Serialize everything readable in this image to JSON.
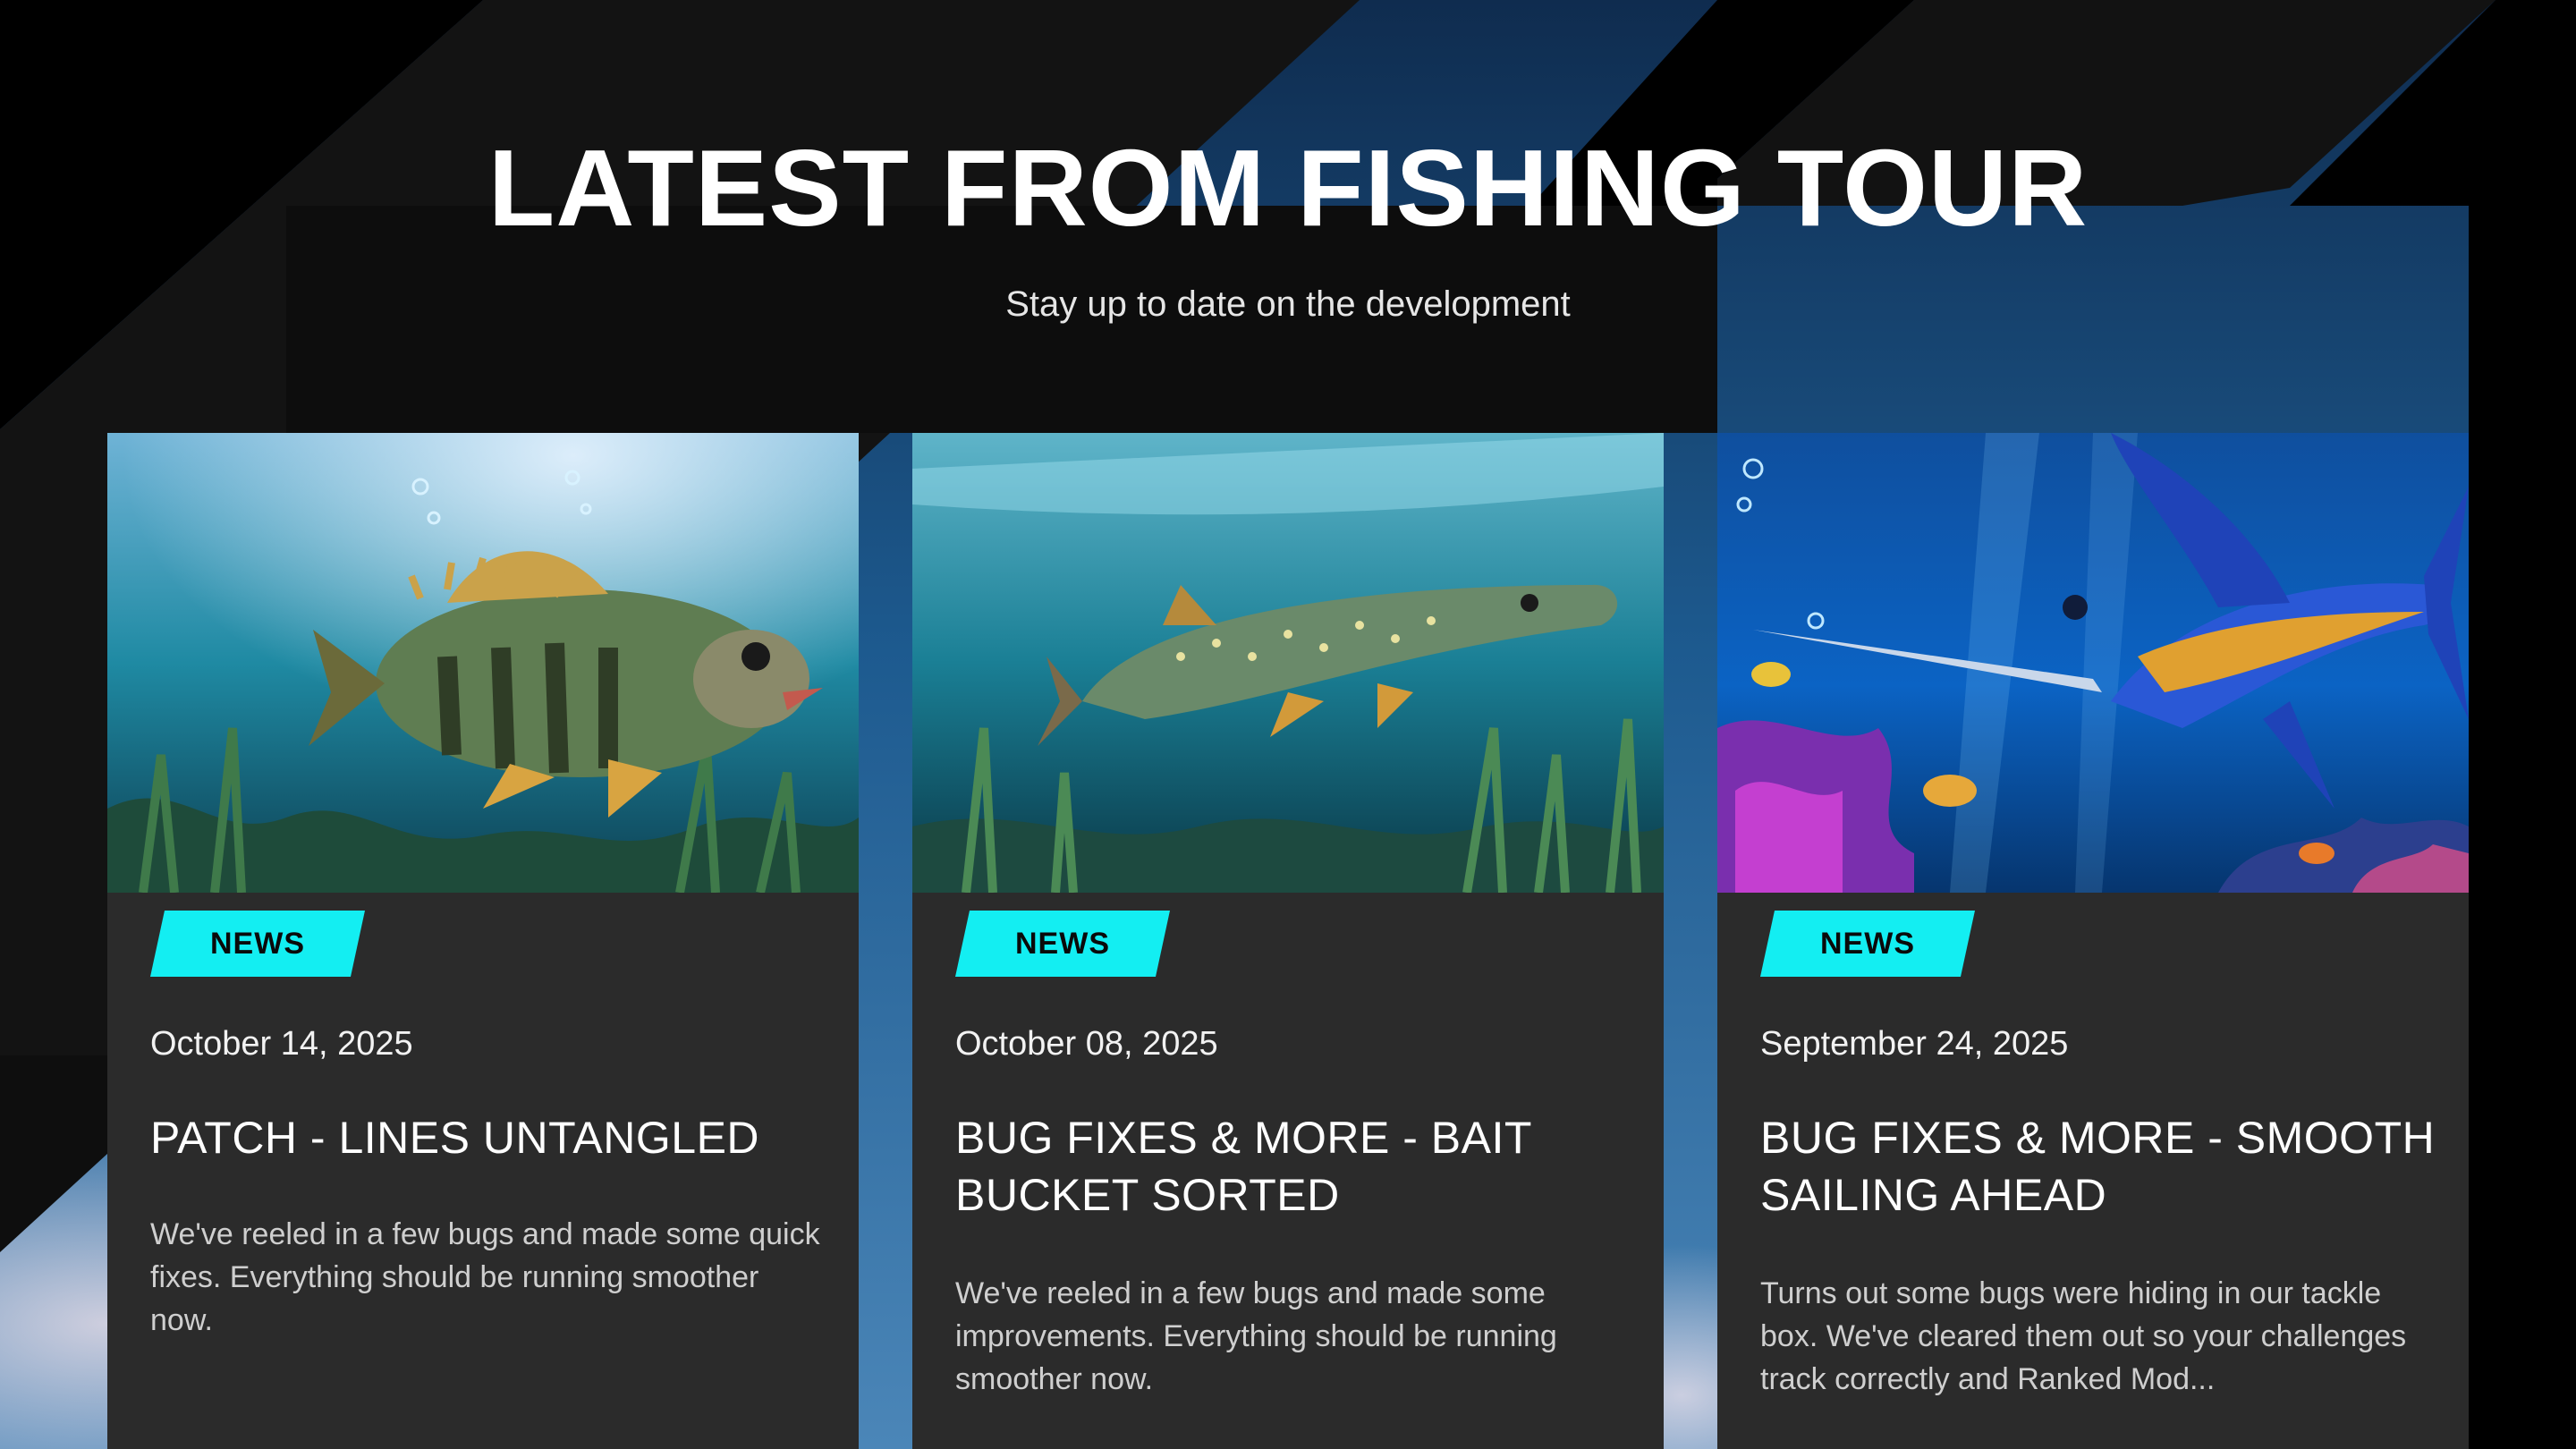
{
  "header": {
    "title": "LATEST FROM FISHING TOUR",
    "subtitle": "Stay up to date on the development"
  },
  "colors": {
    "badge": "#13eef2",
    "card_background": "#2b2b2b",
    "page_background": "#000000"
  },
  "cards": [
    {
      "image": "perch-underwater-image",
      "badge": "NEWS",
      "date": "October 14, 2025",
      "title": "PATCH - LINES UNTANGLED",
      "text": "We've reeled in a few bugs and made some quick fixes. Everything should be running smoother now."
    },
    {
      "image": "pike-underwater-image",
      "badge": "NEWS",
      "date": "October 08, 2025",
      "title": "BUG FIXES & MORE - BAIT BUCKET SORTED",
      "text": "We've reeled in a few bugs and made some improvements. Everything should be running smoother now."
    },
    {
      "image": "marlin-reef-image",
      "badge": "NEWS",
      "date": "September 24, 2025",
      "title": "BUG FIXES & MORE - SMOOTH SAILING AHEAD",
      "text": "Turns out some bugs were hiding in our tackle box. We've cleared them out so your challenges track correctly and Ranked Mod..."
    }
  ]
}
